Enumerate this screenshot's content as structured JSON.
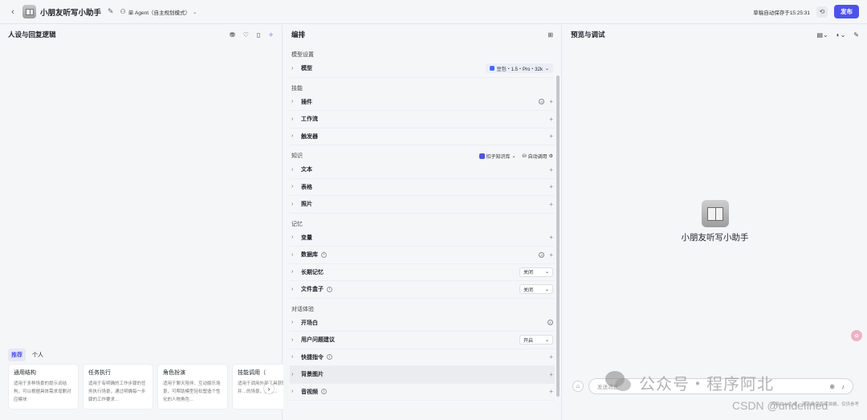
{
  "header": {
    "back_glyph": "‹",
    "title": "小朋友听写小助手",
    "mode_label": "单 Agent（自主规划模式）",
    "save_status": "草稿自动保存于15:25:31",
    "publish_label": "发布"
  },
  "left": {
    "title": "人设与回复逻辑",
    "tabs": [
      "推荐",
      "个人"
    ],
    "cards": [
      {
        "title": "通用结构",
        "desc": "适用于多种场景的提示词结构，可以根据具体需求增删对应模块"
      },
      {
        "title": "任务执行",
        "desc": "适用于有明确的工作步骤的任务执行场景，通过明确每一步骤的工作要求…"
      },
      {
        "title": "角色扮演",
        "desc": "适用于聊天陪伴、互动娱乐场景，可帮助模型轻松塑造个性化的人物角色…"
      },
      {
        "title": "技能调用（",
        "desc": "适用于调用外部工具获取信息并…的场景，使用…"
      }
    ]
  },
  "middle": {
    "title": "编排",
    "model_section": "模型设置",
    "model_row": "模型",
    "model_value": "豆包・1.5・Pro・32k",
    "skills_section": "技能",
    "skills": [
      "插件",
      "工作流",
      "触发器"
    ],
    "knowledge_section": "知识",
    "kb_label": "扣子知识库",
    "auto_label": "自动调用",
    "knowledge": [
      "文本",
      "表格",
      "照片"
    ],
    "memory_section": "记忆",
    "memory": {
      "var": "变量",
      "db": "数据库",
      "ltm": "长期记忆",
      "ltm_value": "关闭",
      "filebox": "文件盒子",
      "filebox_value": "关闭"
    },
    "dialog_section": "对话体验",
    "dialog": {
      "opening": "开场白",
      "suggest": "用户问题建议",
      "suggest_value": "开启",
      "shortcut": "快捷指令",
      "bg": "背景图片",
      "av": "音视频"
    }
  },
  "right": {
    "title": "预览与调试",
    "bot_name": "小朋友听写小助手",
    "input_placeholder": "发送消息",
    "disclaimer": "内容由AI生成，无法确保真实准确，仅供参考"
  },
  "watermark": {
    "line1": "公众号・程序阿北",
    "line2": "CSDN @undefined"
  }
}
